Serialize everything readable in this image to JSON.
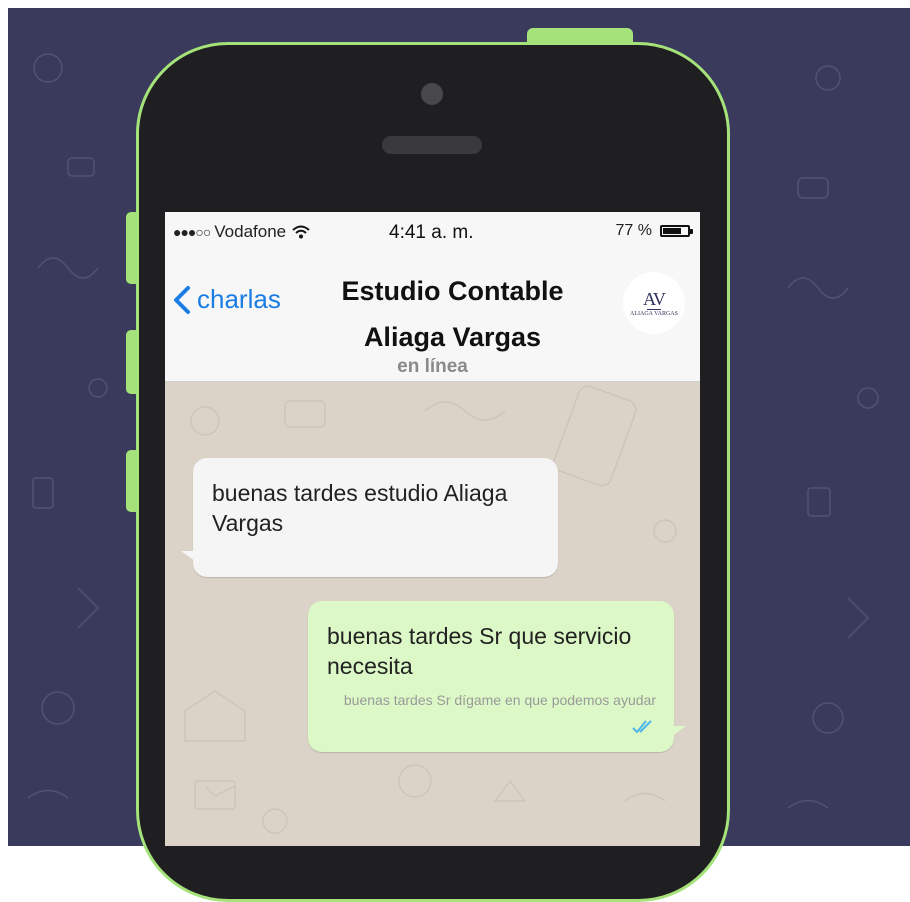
{
  "status_bar": {
    "signal": "●●●○○",
    "carrier": "Vodafone",
    "wifi_icon": "wifi-icon",
    "time": "4:41 a. m.",
    "battery": "77 %",
    "battery_level": 0.77
  },
  "nav": {
    "back_label": "charlas",
    "title_line1": "Estudio Contable",
    "title_line2": "Aliaga Vargas",
    "status": "en línea",
    "avatar": {
      "monogram": "AV",
      "name": "ALIAGA VARGAS"
    }
  },
  "messages": [
    {
      "direction": "incoming",
      "text": "buenas tardes estudio Aliaga Vargas"
    },
    {
      "direction": "outgoing",
      "text": "buenas tardes Sr que servicio necesita",
      "meta": "buenas tardes Sr dígame en que podemos ayudar",
      "read_icon": "double-check-icon"
    }
  ],
  "colors": {
    "background": "#3a3a5c",
    "phone_frame": "#a5e27a",
    "accent": "#1a7de3",
    "outgoing_bubble": "#dcf8c6",
    "incoming_bubble": "#f5f5f5",
    "read_ticks": "#4fb6ec"
  }
}
